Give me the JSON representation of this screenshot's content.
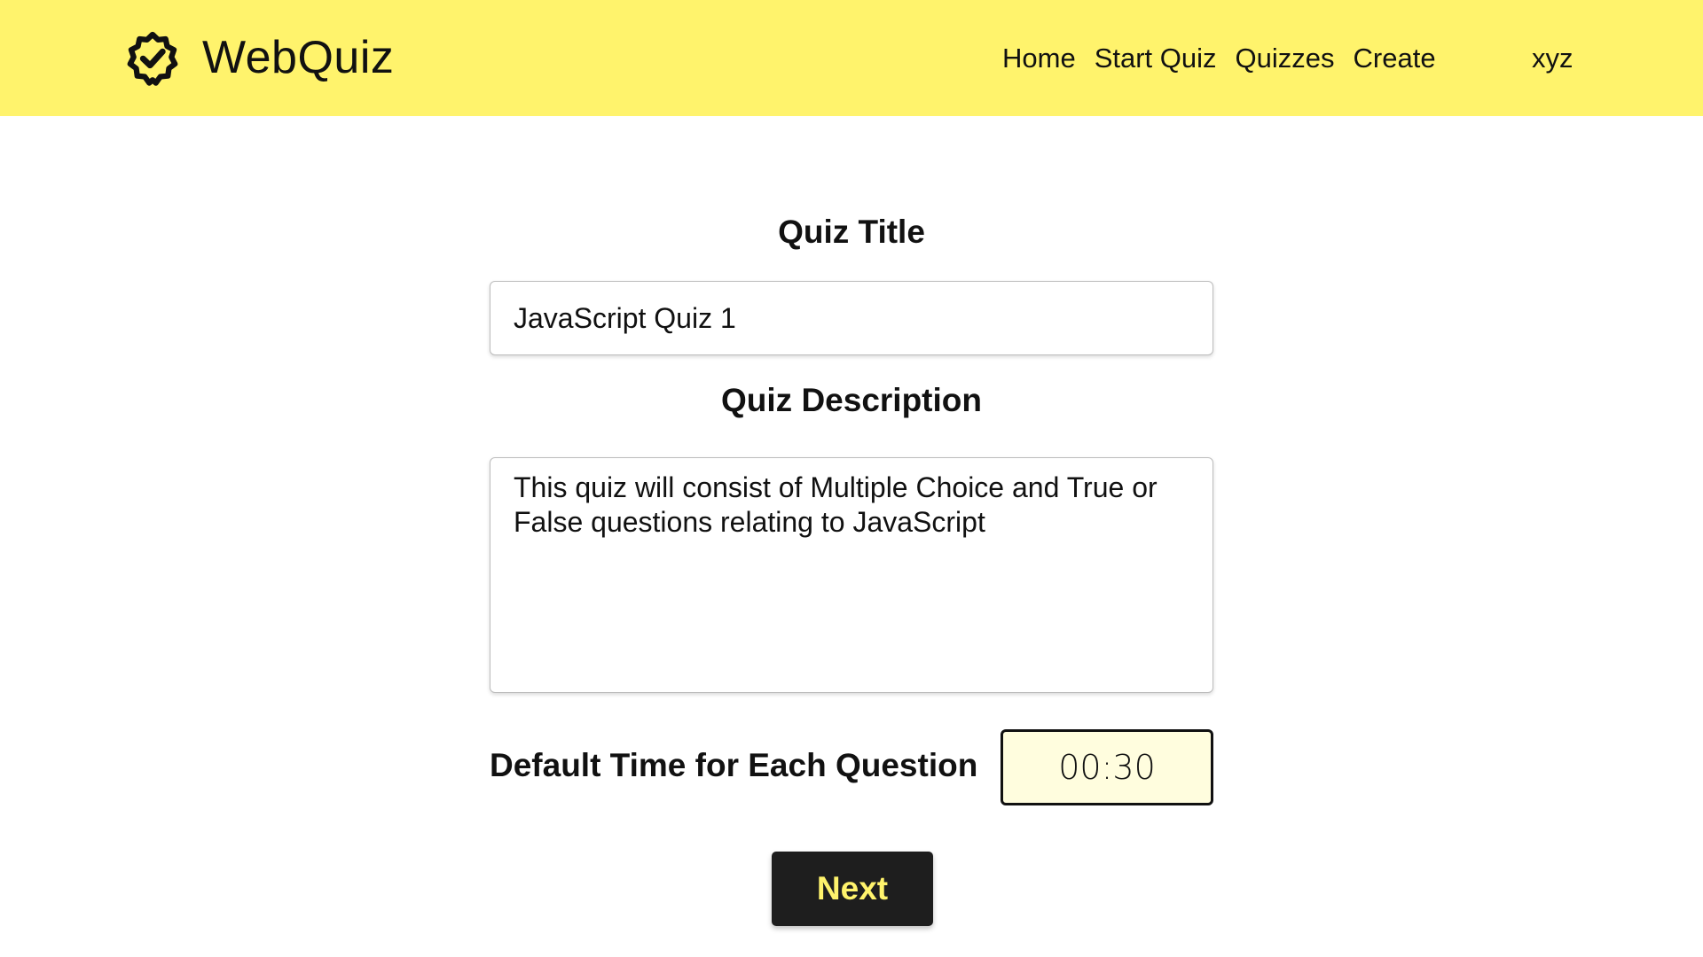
{
  "theme": {
    "accent": "#fff36c",
    "button_bg": "#1e1e1e",
    "time_field_bg": "#fffdde"
  },
  "navbar": {
    "brand": {
      "name": "WebQuiz",
      "icon": "gear-check-icon"
    },
    "links": [
      {
        "label": "Home"
      },
      {
        "label": "Start Quiz"
      },
      {
        "label": "Quizzes"
      },
      {
        "label": "Create"
      }
    ],
    "user": "xyz"
  },
  "form": {
    "title_label": "Quiz Title",
    "title_value": "JavaScript Quiz 1",
    "description_label": "Quiz Description",
    "description_value": "This quiz will consist of Multiple Choice and True or False questions relating to JavaScript",
    "time_label": "Default Time for Each Question",
    "time_value": "00:30",
    "next_label": "Next"
  }
}
